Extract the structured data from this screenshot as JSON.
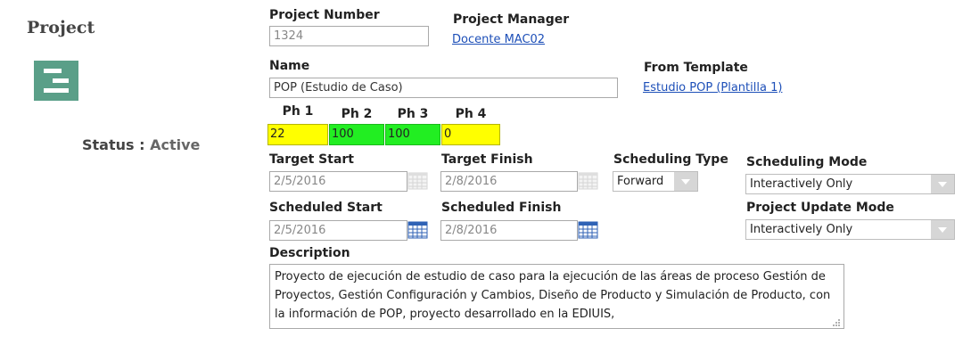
{
  "left": {
    "title": "Project",
    "status_label": "Status :",
    "status_value": "Active"
  },
  "fields": {
    "project_number": {
      "label": "Project Number",
      "value": "1324"
    },
    "project_manager": {
      "label": "Project Manager",
      "value": "Docente MAC02"
    },
    "name": {
      "label": "Name",
      "value": "POP (Estudio de Caso)"
    },
    "from_template": {
      "label": "From Template",
      "value": "Estudio POP (Plantilla 1)"
    },
    "phases": [
      {
        "label": "Ph 1",
        "value": "22",
        "color": "#ffff00"
      },
      {
        "label": "Ph 2",
        "value": "100",
        "color": "#22ee22"
      },
      {
        "label": "Ph 3",
        "value": "100",
        "color": "#22ee22"
      },
      {
        "label": "Ph 4",
        "value": "0",
        "color": "#ffff00"
      }
    ],
    "target_start": {
      "label": "Target Start",
      "value": "2/5/2016"
    },
    "target_finish": {
      "label": "Target Finish",
      "value": "2/8/2016"
    },
    "scheduling_type": {
      "label": "Scheduling Type",
      "value": "Forward"
    },
    "scheduling_mode": {
      "label": "Scheduling Mode",
      "value": "Interactively Only"
    },
    "scheduled_start": {
      "label": "Scheduled Start",
      "value": "2/5/2016"
    },
    "scheduled_finish": {
      "label": "Scheduled Finish",
      "value": "2/8/2016"
    },
    "project_update_mode": {
      "label": "Project Update Mode",
      "value": "Interactively Only"
    },
    "description": {
      "label": "Description",
      "value": "Proyecto de ejecución de estudio de caso para la ejecución de las áreas de proceso Gestión de Proyectos, Gestión Configuración y Cambios, Diseño de Producto y Simulación de Producto, con la información de POP, proyecto desarrollado en la EDIUIS,"
    }
  },
  "colors": {
    "logo": "#5a9f88",
    "link": "#1d4fb8",
    "calendar_active": "#2f62b5"
  },
  "icons": [
    "project-logo-icon",
    "calendar-icon",
    "chevron-down-icon",
    "resize-grip-icon"
  ]
}
